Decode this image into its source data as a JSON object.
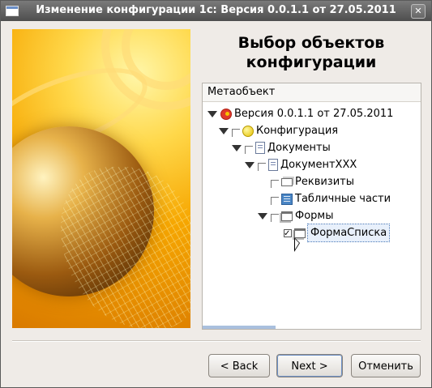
{
  "window": {
    "title": "Изменение конфигурации 1с:  Версия 0.0.1.1 от 27.05.2011",
    "close_glyph": "✕"
  },
  "page": {
    "title_line1": "Выбор объектов",
    "title_line2": "конфигурации"
  },
  "tree": {
    "column_header": "Метаобъект",
    "items": [
      {
        "label": "Версия 0.0.1.1 от 27.05.2011",
        "icon": "version-1c-icon",
        "expanded": true,
        "checkbox": false
      },
      {
        "label": "Конфигурация",
        "icon": "configuration-icon",
        "expanded": true,
        "checkbox": true
      },
      {
        "label": "Документы",
        "icon": "documents-icon",
        "expanded": true,
        "checkbox": true
      },
      {
        "label": "ДокументXXX",
        "icon": "document-icon",
        "expanded": true,
        "checkbox": true
      },
      {
        "label": "Реквизиты",
        "icon": "attributes-icon",
        "expanded": false,
        "checkbox": true
      },
      {
        "label": "Табличные части",
        "icon": "tabular-parts-icon",
        "expanded": false,
        "checkbox": true
      },
      {
        "label": "Формы",
        "icon": "forms-icon",
        "expanded": true,
        "checkbox": true
      },
      {
        "label": "ФормаСписка",
        "icon": "form-icon",
        "expanded": false,
        "checkbox": true,
        "checked": true,
        "selected": true
      }
    ]
  },
  "buttons": {
    "back": "< Back",
    "next": "Next >",
    "cancel": "Отменить"
  }
}
